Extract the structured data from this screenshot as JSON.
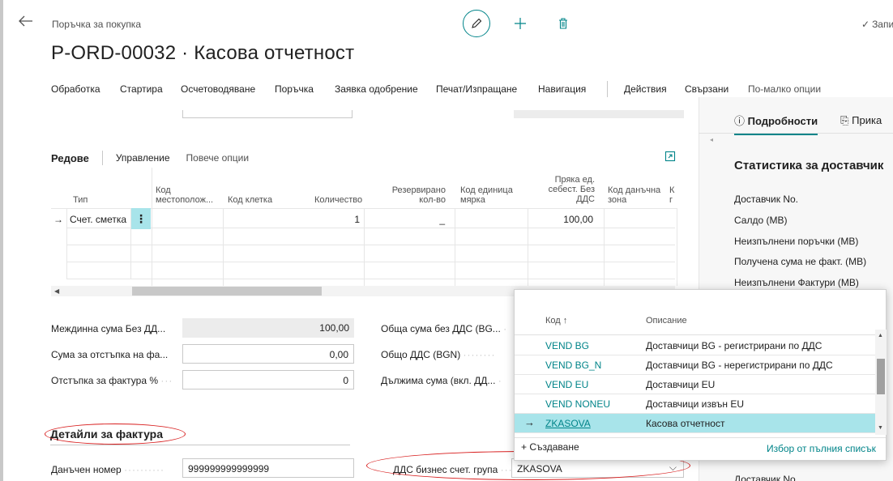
{
  "header": {
    "breadcrumb": "Поръчка за покупка",
    "title": "P-ORD-00032 · Касова отчетност",
    "save_status": "Запи"
  },
  "action_bar": {
    "items": [
      "Обработка",
      "Стартира",
      "Осчетоводяване",
      "Поръчка",
      "Заявка одобрение",
      "Печат/Изпращане",
      "Навигация",
      "Действия",
      "Свързани",
      "По-малко опции"
    ]
  },
  "lines": {
    "title": "Редове",
    "actions": [
      "Управление",
      "Повече опции"
    ],
    "columns": {
      "type": "Тип",
      "location": "Код местополож...",
      "bin": "Код клетка",
      "quantity": "Количество",
      "reserved": "Резервирано кол-во",
      "uom": "Код единица мярка",
      "unit_cost": "Пряка ед. себест. Без ДДС",
      "tax_area": "Код данъчна зона",
      "cut": "К г"
    },
    "row": {
      "type": "Счет. сметка",
      "quantity": "1",
      "reserved": "_",
      "unit_cost": "100,00"
    }
  },
  "totals": {
    "subtotal_label": "Междинна сума Без ДД...",
    "subtotal_value": "100,00",
    "discount_amount_label": "Сума за отстъпка на фа...",
    "discount_amount_value": "0,00",
    "discount_pct_label": "Отстъпка за фактура %",
    "discount_pct_value": "0",
    "total_excl_label": "Обща сума без ДДС (BG...",
    "total_vat_label": "Общо ДДС (BGN)",
    "total_incl_label": "Дължима сума (вкл. ДД..."
  },
  "invoice": {
    "title": "Детайли за фактура",
    "tax_no_label": "Данъчен номер",
    "tax_no_value": "999999999999999",
    "vat_group_label": "ДДС бизнес счет. група",
    "vat_group_value": "ZKASOVA"
  },
  "factbox": {
    "tab_details": "Подробности",
    "tab_attach": "Прика",
    "stats_title": "Статистика за доставчик",
    "items": [
      "Доставчик No.",
      "Салдо (MB)",
      "Неизпълнени поръчки (MB)",
      "Получена сума не факт. (MB)",
      "Неизпълнени Фактури (MB)"
    ],
    "bottom_item": "Доставчик No."
  },
  "dropdown": {
    "col_code": "Код",
    "col_desc": "Описание",
    "rows": [
      {
        "code": "VEND BG",
        "desc": "Доставчици BG - регистрирани по ДДС"
      },
      {
        "code": "VEND BG_N",
        "desc": "Доставчици BG - нерегистрирани по ДДС"
      },
      {
        "code": "VEND EU",
        "desc": "Доставчици EU"
      },
      {
        "code": "VEND NONEU",
        "desc": "Доставчици извън EU"
      },
      {
        "code": "ZKASOVA",
        "desc": "Касова отчетност"
      }
    ],
    "create_label": "Създаване",
    "full_list_label": "Избор от пълния списък"
  },
  "colors": {
    "accent": "#008489",
    "selection": "#a8e4ea",
    "annotation": "#d81e1e"
  }
}
